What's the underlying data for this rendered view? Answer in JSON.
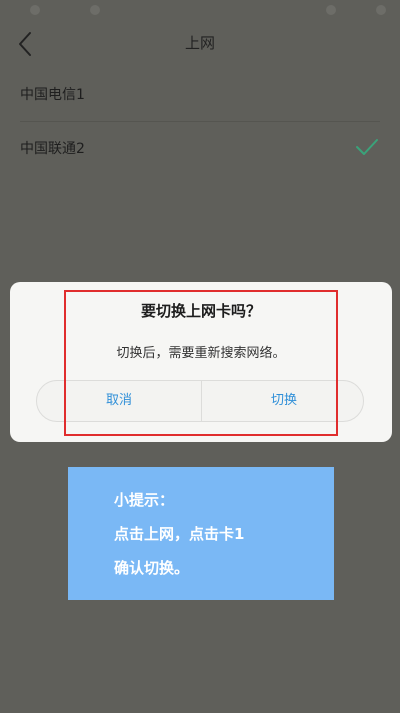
{
  "header": {
    "title": "上网",
    "back_icon": "chevron-left-icon"
  },
  "sim_list": [
    {
      "label": "中国电信1",
      "selected": false
    },
    {
      "label": "中国联通2",
      "selected": true
    }
  ],
  "dialog": {
    "title": "要切换上网卡吗？",
    "message": "切换后，需要重新搜索网络。",
    "cancel_label": "取消",
    "confirm_label": "切换"
  },
  "tip": {
    "lines": [
      "小提示：",
      "点击上网，点击卡1",
      "确认切换。"
    ]
  },
  "colors": {
    "accent": "#2f8fd8",
    "check": "#3aa37a",
    "highlight": "#e02d2d",
    "tip_bg": "#7ab8f5"
  }
}
